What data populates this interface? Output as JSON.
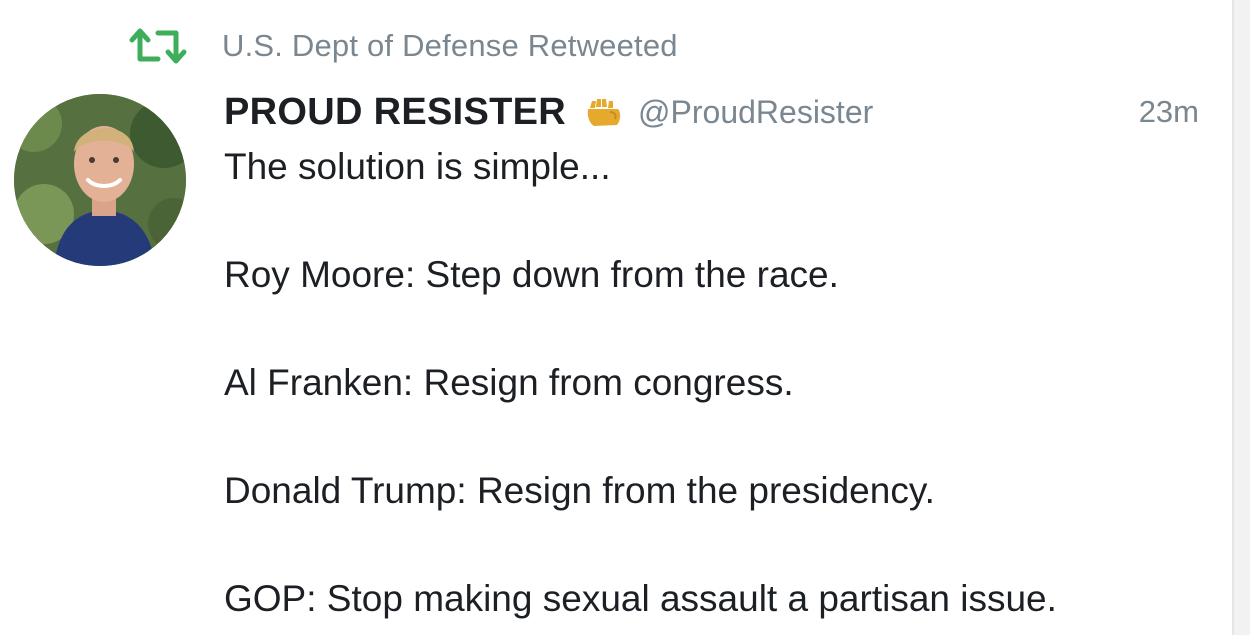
{
  "retweet_context": {
    "icon": "retweet-icon",
    "text": "U.S. Dept of Defense Retweeted",
    "icon_color": "#3fae5c"
  },
  "author": {
    "avatar_icon": "avatar",
    "display_name": "PROUD RESISTER",
    "badge_icon": "raised-fist-icon",
    "handle": "@ProudResister",
    "timestamp": "23m"
  },
  "tweet": {
    "lines": [
      "The solution is simple...",
      "Roy Moore: Step down from the race.",
      "Al Franken: Resign from congress.",
      "Donald Trump: Resign from the presidency.",
      "GOP: Stop making sexual assault a partisan issue."
    ]
  },
  "colors": {
    "text": "#1c2025",
    "secondary_text": "#7a8791",
    "retweet_green": "#3fae5c",
    "fist_yellow": "#e5a92d"
  }
}
